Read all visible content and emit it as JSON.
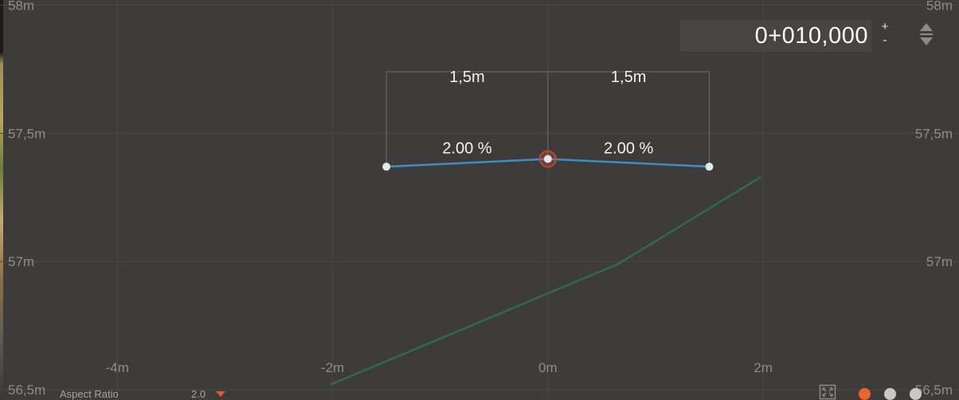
{
  "station": {
    "value": "0+010,000",
    "plus_label": "+",
    "minus_label": "-"
  },
  "footer": {
    "aspect_label": "Aspect Ratio",
    "aspect_value": "2.0"
  },
  "pagination": {
    "active_index": 0,
    "count": 3,
    "active_color": "#e8652d",
    "inactive_color": "#c8c8c8"
  },
  "colors": {
    "background": "#3e3c3a",
    "template_line": "#3e8ec4",
    "ground_line": "#2f6a4f",
    "handle": "#e6e6e6",
    "selected_ring": "#b8483a"
  },
  "chart_data": {
    "type": "line",
    "x_axis": {
      "ticks": [
        -4,
        -2,
        0,
        2
      ],
      "tick_labels": [
        "-4m",
        "-2m",
        "0m",
        "2m"
      ],
      "range": [
        -5.09,
        3.82
      ]
    },
    "y_axis": {
      "ticks": [
        56.5,
        57,
        57.5,
        58
      ],
      "left_tick_labels": [
        "56,5m",
        "57m",
        "57,5m",
        "58m"
      ],
      "right_tick_labels": [
        "56,5m",
        "57m",
        "57,5m",
        "58m"
      ],
      "range": [
        56.46,
        58.02
      ]
    },
    "grid": true,
    "series": [
      {
        "role": "template",
        "points": [
          {
            "x": -1.5,
            "y": 57.37
          },
          {
            "x": 0,
            "y": 57.4
          },
          {
            "x": 1.5,
            "y": 57.37
          }
        ],
        "selected_point": 1
      },
      {
        "role": "ground",
        "points": [
          {
            "x": -2.02,
            "y": 56.52
          },
          {
            "x": 0.65,
            "y": 56.99
          },
          {
            "x": 1.98,
            "y": 57.33
          }
        ]
      }
    ],
    "dimensions": [
      {
        "from": -1.5,
        "to": 0,
        "label": "1,5m"
      },
      {
        "from": 0,
        "to": 1.5,
        "label": "1,5m"
      }
    ],
    "slopes": [
      {
        "from": -1.5,
        "to": 0,
        "label": "2.00 %"
      },
      {
        "from": 0,
        "to": 1.5,
        "label": "2.00 %"
      }
    ]
  }
}
